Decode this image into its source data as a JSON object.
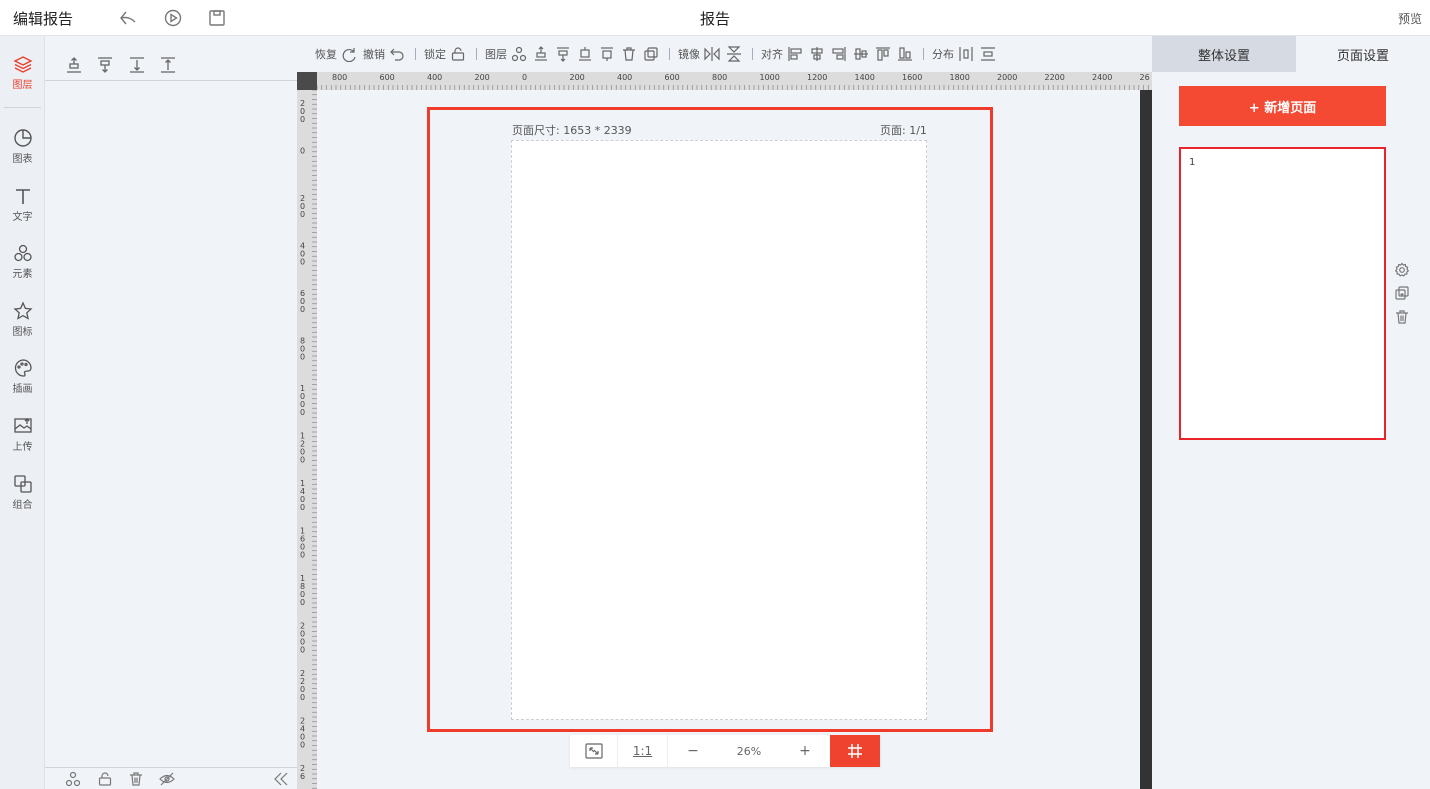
{
  "header": {
    "app_title": "编辑报告",
    "page_title": "报告",
    "preview_label": "预览"
  },
  "left_rail": {
    "items": [
      {
        "label": "图层",
        "icon": "layers-icon",
        "active": true
      },
      {
        "label": "图表",
        "icon": "pie-chart-icon"
      },
      {
        "label": "文字",
        "icon": "text-icon"
      },
      {
        "label": "元素",
        "icon": "elements-icon"
      },
      {
        "label": "图标",
        "icon": "star-icon"
      },
      {
        "label": "插画",
        "icon": "palette-icon"
      },
      {
        "label": "上传",
        "icon": "image-upload-icon"
      },
      {
        "label": "组合",
        "icon": "combine-icon"
      }
    ]
  },
  "toolbar": {
    "redo_label": "恢复",
    "undo_label": "撤销",
    "lock_label": "锁定",
    "layer_label": "图层",
    "mirror_label": "镜像",
    "align_label": "对齐",
    "distribute_label": "分布"
  },
  "ruler": {
    "top_ticks": [
      "800",
      "600",
      "400",
      "200",
      "0",
      "200",
      "400",
      "600",
      "800",
      "1000",
      "1200",
      "1400",
      "1600",
      "1800",
      "2000",
      "2200",
      "2400",
      "26"
    ],
    "left_ticks": [
      "200",
      "0",
      "200",
      "400",
      "600",
      "800",
      "1000",
      "1200",
      "1400",
      "1600",
      "1800",
      "2000",
      "2200",
      "2400",
      "26"
    ]
  },
  "canvas": {
    "page_size_label": "页面尺寸: 1653 * 2339",
    "page_number_label": "页面: 1/1"
  },
  "zoom_bar": {
    "ratio_label": "1:1",
    "minus_label": "−",
    "zoom_percent": "26%",
    "plus_label": "+"
  },
  "right_panel": {
    "tab_global": "整体设置",
    "tab_page": "页面设置",
    "add_page_label": "+ 新增页面",
    "thumbnail_number": "1"
  },
  "colors": {
    "accent": "#f44a33",
    "selection_border": "#f03a2a",
    "thumbnail_border": "#e8232a"
  }
}
